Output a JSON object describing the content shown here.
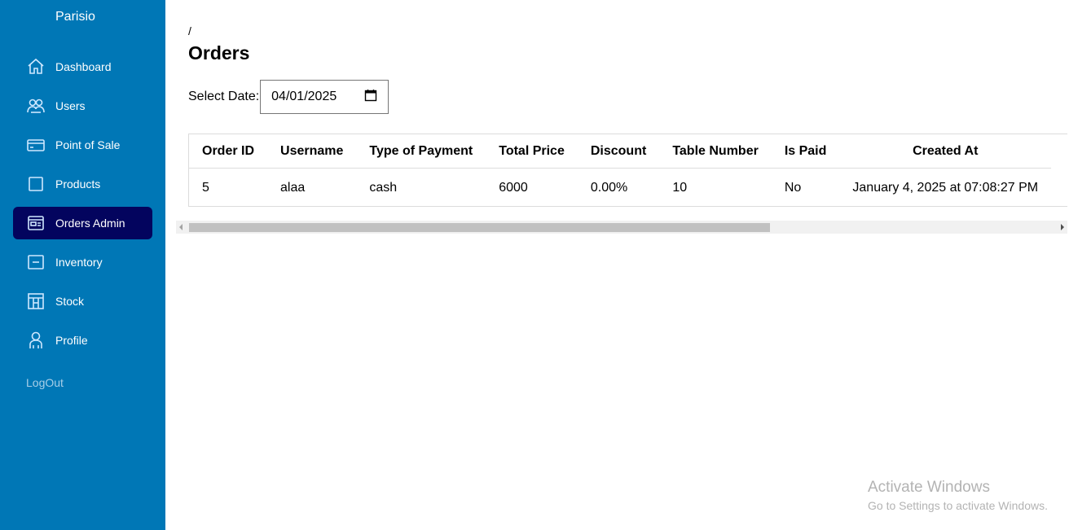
{
  "app": {
    "brand": "Parisio"
  },
  "sidebar": {
    "items": [
      {
        "label": "Dashboard",
        "icon": "home-icon",
        "active": false
      },
      {
        "label": "Users",
        "icon": "users-icon",
        "active": false
      },
      {
        "label": "Point of Sale",
        "icon": "credit-card-icon",
        "active": false
      },
      {
        "label": "Products",
        "icon": "box-icon",
        "active": false
      },
      {
        "label": "Orders Admin",
        "icon": "orders-icon",
        "active": true
      },
      {
        "label": "Inventory",
        "icon": "inventory-icon",
        "active": false
      },
      {
        "label": "Stock",
        "icon": "stock-icon",
        "active": false
      },
      {
        "label": "Profile",
        "icon": "profile-icon",
        "active": false
      }
    ],
    "logout_label": "LogOut",
    "colors": {
      "background": "#0077b6",
      "active": "#03045e"
    }
  },
  "main": {
    "breadcrumb": "/",
    "title": "Orders",
    "date_filter": {
      "label": "Select Date:",
      "value": "04/01/2025"
    },
    "table": {
      "columns": [
        "Order ID",
        "Username",
        "Type of Payment",
        "Total Price",
        "Discount",
        "Table Number",
        "Is Paid",
        "Created At"
      ],
      "rows": [
        [
          "5",
          "alaa",
          "cash",
          "6000",
          "0.00%",
          "10",
          "No",
          "January 4, 2025 at 07:08:27 PM"
        ]
      ]
    }
  },
  "watermark": {
    "title": "Activate Windows",
    "subtitle": "Go to Settings to activate Windows."
  }
}
